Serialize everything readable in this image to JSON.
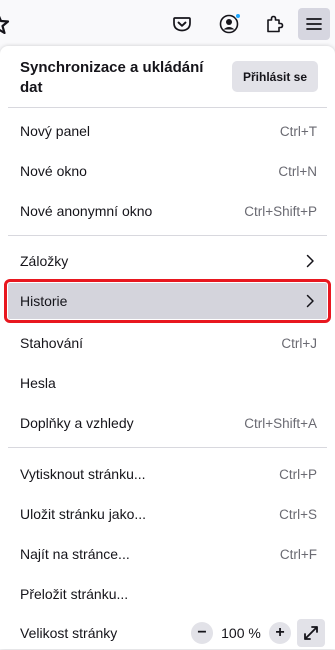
{
  "toolbar": {
    "icons": [
      "bookmark-star-icon",
      "pocket-icon",
      "account-icon",
      "extensions-icon",
      "menu-icon"
    ]
  },
  "sync": {
    "title": "Synchronizace a ukládání dat",
    "signin_label": "Přihlásit se"
  },
  "items": [
    {
      "label": "Nový panel",
      "shortcut": "Ctrl+T"
    },
    {
      "label": "Nové okno",
      "shortcut": "Ctrl+N"
    },
    {
      "label": "Nové anonymní okno",
      "shortcut": "Ctrl+Shift+P"
    },
    {
      "label": "Záložky",
      "shortcut": ""
    },
    {
      "label": "Historie",
      "shortcut": ""
    },
    {
      "label": "Stahování",
      "shortcut": "Ctrl+J"
    },
    {
      "label": "Hesla",
      "shortcut": ""
    },
    {
      "label": "Doplňky a vzhledy",
      "shortcut": "Ctrl+Shift+A"
    },
    {
      "label": "Vytisknout stránku...",
      "shortcut": "Ctrl+P"
    },
    {
      "label": "Uložit stránku jako...",
      "shortcut": "Ctrl+S"
    },
    {
      "label": "Najít na stránce...",
      "shortcut": "Ctrl+F"
    },
    {
      "label": "Přeložit stránku...",
      "shortcut": ""
    }
  ],
  "zoom": {
    "label": "Velikost stránky",
    "minus": "−",
    "value": "100 %",
    "plus": "+"
  },
  "colors": {
    "highlight_outline": "#e8171f",
    "account_badge": "#1ea7ff"
  }
}
